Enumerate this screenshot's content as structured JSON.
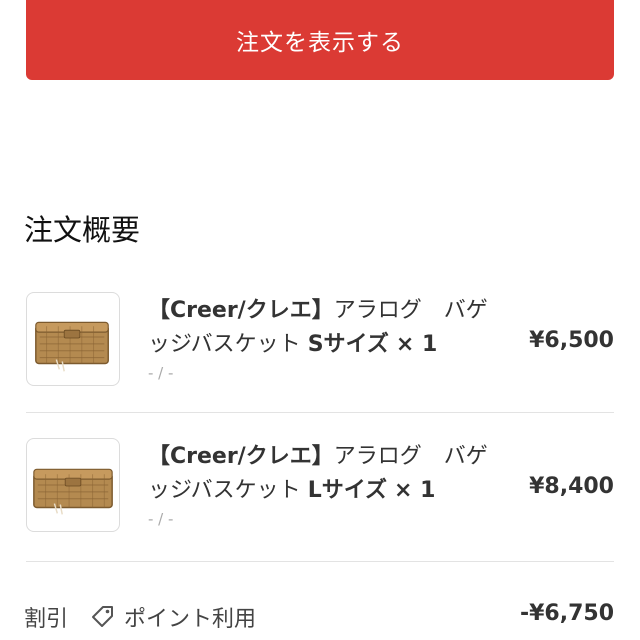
{
  "header": {
    "view_order_label": "注文を表示する",
    "button_color": "#db3a34"
  },
  "summary": {
    "title": "注文概要",
    "items": [
      {
        "title_bold": "【Creer/クレエ】",
        "title_rest": "アラログ　バゲッジバスケット",
        "size_label": "Sサイズ",
        "quantity": "× 1",
        "variant": "- / -",
        "price": "¥6,500",
        "image_icon": "wicker-basket-small-image"
      },
      {
        "title_bold": "【Creer/クレエ】",
        "title_rest": "アラログ　バゲッジバスケット",
        "size_label": "Lサイズ",
        "quantity": "× 1",
        "variant": "- / -",
        "price": "¥8,400",
        "image_icon": "wicker-basket-large-image"
      }
    ],
    "discount": {
      "label": "割引",
      "icon": "tag-icon",
      "points_label": "ポイント利用",
      "amount": "-¥6,750"
    }
  }
}
